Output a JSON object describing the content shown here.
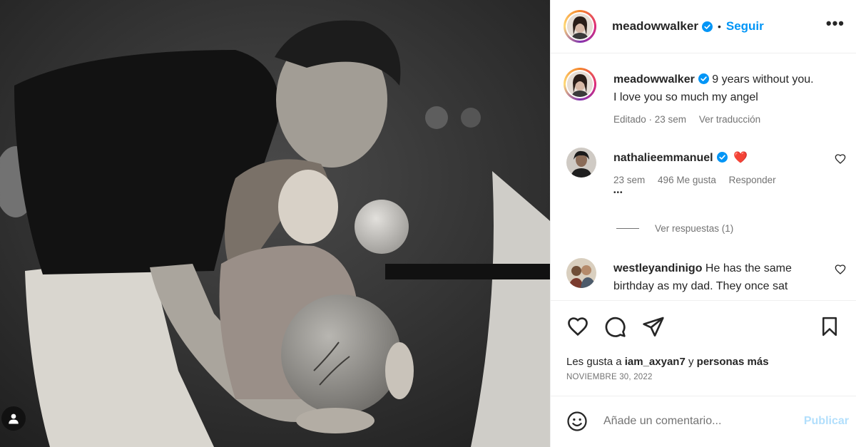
{
  "post": {
    "photo": {
      "alt": "",
      "tagged_icon": "person-tag-icon"
    },
    "header": {
      "username": "meadowwalker",
      "verified_icon": "verified-badge-icon",
      "separator": "•",
      "follow_label": "Seguir",
      "more_icon": "more-options-icon",
      "more_label": "•••"
    },
    "caption": {
      "username": "meadowwalker",
      "text": "9 years without you. I love you so much my angel",
      "edited": "Editado · 23 sem",
      "translate": "Ver traducción"
    },
    "comments": [
      {
        "username": "nathalieemmanuel",
        "text": "❤️",
        "time": "23 sem",
        "likes": "496 Me gusta",
        "reply": "Responder",
        "more": "•••",
        "view_replies": "Ver respuestas (1)"
      },
      {
        "username": "westleyandinigo",
        "text": "He has the same birthday as my dad. They once sat"
      }
    ],
    "actions": {
      "like_icon": "heart-icon",
      "comment_icon": "comment-icon",
      "share_icon": "share-icon",
      "save_icon": "bookmark-icon"
    },
    "likes": {
      "prefix": "Les gusta a",
      "user": "iam_axyan7",
      "middle": "y",
      "suffix": "personas más"
    },
    "date": "NOVIEMBRE 30, 2022",
    "add_comment": {
      "emoji_icon": "emoji-icon",
      "placeholder": "Añade un comentario...",
      "publish_label": "Publicar"
    },
    "colors": {
      "accent": "#0095f6",
      "verified": "#0095f6",
      "heart": "#ed4956",
      "publish_disabled": "#b2dffc"
    }
  }
}
